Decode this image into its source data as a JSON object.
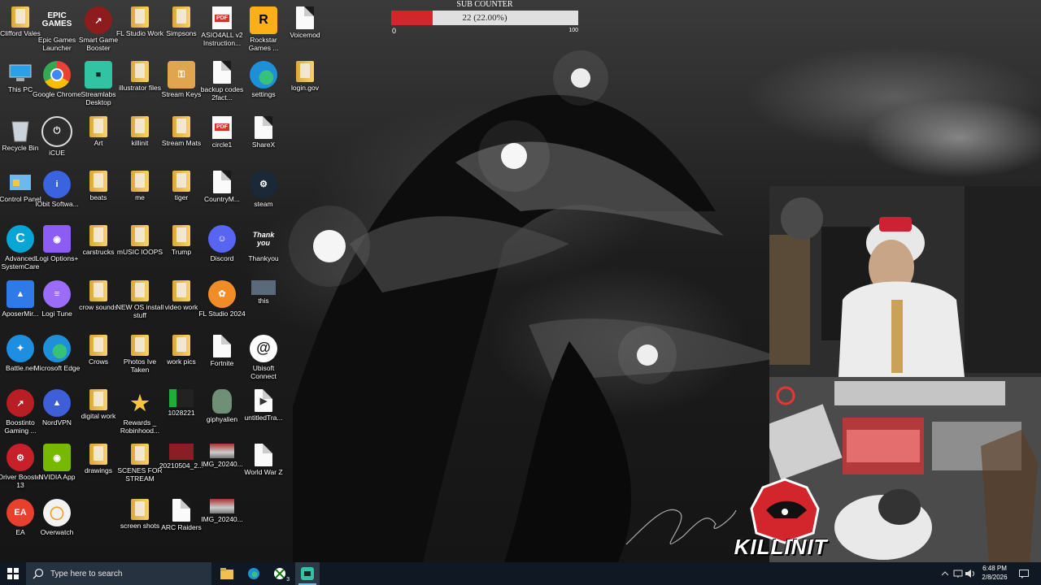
{
  "desktop": {
    "icons": [
      {
        "label": "Clifford Vales",
        "icon": "folder-user-icon",
        "type": "folder"
      },
      {
        "label": "This PC",
        "icon": "this-pc-icon",
        "type": "pc"
      },
      {
        "label": "Recycle Bin",
        "icon": "recycle-bin-icon",
        "type": "bin"
      },
      {
        "label": "Control Panel",
        "icon": "control-panel-icon",
        "type": "cp"
      },
      {
        "label": "Advanced SystemCare",
        "icon": "advanced-systemcare-icon",
        "type": "asc"
      },
      {
        "label": "AposerMir...",
        "icon": "apowermirror-icon",
        "type": "apower"
      },
      {
        "label": "Battle.net",
        "icon": "battlenet-icon",
        "type": "battle"
      },
      {
        "label": "Boostinto Gaming ...",
        "icon": "boost-gaming-icon",
        "type": "boost"
      },
      {
        "label": "Driver Booster 13",
        "icon": "driver-booster-icon",
        "type": "driver"
      },
      {
        "label": "EA",
        "icon": "ea-icon",
        "type": "ea"
      },
      {
        "label": "Epic Games Launcher",
        "icon": "epic-games-icon",
        "type": "epic"
      },
      {
        "label": "Google Chrome",
        "icon": "chrome-icon",
        "type": "chrome"
      },
      {
        "label": "iCUE",
        "icon": "icue-icon",
        "type": "icue"
      },
      {
        "label": "IObit Softwa...",
        "icon": "iobit-icon",
        "type": "iobit"
      },
      {
        "label": "Logi Options+",
        "icon": "logi-options-icon",
        "type": "logi"
      },
      {
        "label": "Logi Tune",
        "icon": "logi-tune-icon",
        "type": "logitune"
      },
      {
        "label": "Microsoft Edge",
        "icon": "edge-icon",
        "type": "edge"
      },
      {
        "label": "NordVPN",
        "icon": "nordvpn-icon",
        "type": "nord"
      },
      {
        "label": "NVIDIA App",
        "icon": "nvidia-icon",
        "type": "nvidia"
      },
      {
        "label": "Overwatch",
        "icon": "overwatch-icon",
        "type": "overwatch"
      },
      {
        "label": "Smart Game Booster",
        "icon": "smart-game-booster-icon",
        "type": "sgb"
      },
      {
        "label": "Streamlabs Desktop",
        "icon": "streamlabs-icon",
        "type": "streamlabs"
      },
      {
        "label": "Art",
        "icon": "folder-icon",
        "type": "folder"
      },
      {
        "label": "beats",
        "icon": "folder-icon",
        "type": "folder"
      },
      {
        "label": "carstrucks",
        "icon": "folder-icon",
        "type": "folder"
      },
      {
        "label": "crow sounds",
        "icon": "folder-icon",
        "type": "folder"
      },
      {
        "label": "Crows",
        "icon": "folder-icon",
        "type": "folder"
      },
      {
        "label": "digital work",
        "icon": "folder-icon",
        "type": "folder"
      },
      {
        "label": "drawings",
        "icon": "folder-icon",
        "type": "folder"
      },
      {
        "label": "FL Studio Work",
        "icon": "folder-icon",
        "type": "folder"
      },
      {
        "label": "illustrator files",
        "icon": "folder-icon",
        "type": "folder"
      },
      {
        "label": "killinit",
        "icon": "folder-icon",
        "type": "folder"
      },
      {
        "label": "me",
        "icon": "folder-icon",
        "type": "folder"
      },
      {
        "label": "mUSIC lOOPS",
        "icon": "folder-icon",
        "type": "folder"
      },
      {
        "label": "NEW OS install stuff",
        "icon": "folder-icon",
        "type": "folder"
      },
      {
        "label": "Photos Ive Taken",
        "icon": "folder-icon",
        "type": "folder"
      },
      {
        "label": "Rewards _ Robinhood...",
        "icon": "rewards-star-icon",
        "type": "star"
      },
      {
        "label": "SCENES FOR STREAM",
        "icon": "folder-icon",
        "type": "folder"
      },
      {
        "label": "screen shots",
        "icon": "folder-icon",
        "type": "folder"
      },
      {
        "label": "Simpsons",
        "icon": "folder-icon",
        "type": "folder"
      },
      {
        "label": "Stream Keys",
        "icon": "stream-keys-icon",
        "type": "keys"
      },
      {
        "label": "Stream Mats",
        "icon": "folder-icon",
        "type": "folder"
      },
      {
        "label": "tiger",
        "icon": "folder-icon",
        "type": "folder"
      },
      {
        "label": "Trump",
        "icon": "folder-icon",
        "type": "folder"
      },
      {
        "label": "video work",
        "icon": "folder-icon",
        "type": "folder"
      },
      {
        "label": "work pics",
        "icon": "folder-icon",
        "type": "folder"
      },
      {
        "label": "1028221",
        "icon": "image-file-icon",
        "type": "img1"
      },
      {
        "label": "20210504_2...",
        "icon": "image-file-icon",
        "type": "img2"
      },
      {
        "label": "ARC Raiders",
        "icon": "document-icon",
        "type": "doc"
      },
      {
        "label": "ASIO4ALL v2 Instruction...",
        "icon": "pdf-icon",
        "type": "pdf"
      },
      {
        "label": "backup codes 2fact...",
        "icon": "document-icon",
        "type": "doc"
      },
      {
        "label": "circle1",
        "icon": "pdf-icon",
        "type": "pdf"
      },
      {
        "label": "CountryM...",
        "icon": "document-icon",
        "type": "doc"
      },
      {
        "label": "Discord",
        "icon": "discord-icon",
        "type": "discord"
      },
      {
        "label": "FL Studio 2024",
        "icon": "fl-studio-icon",
        "type": "fl"
      },
      {
        "label": "Fortnite",
        "icon": "document-icon",
        "type": "doc"
      },
      {
        "label": "giphyalien",
        "icon": "alien-image-icon",
        "type": "alien"
      },
      {
        "label": "IMG_20240...",
        "icon": "image-file-icon",
        "type": "img3"
      },
      {
        "label": "IMG_20240...",
        "icon": "image-file-icon",
        "type": "img3"
      },
      {
        "label": "Rockstar Games ...",
        "icon": "rockstar-icon",
        "type": "rockstar"
      },
      {
        "label": "settings",
        "icon": "edge-icon",
        "type": "edge"
      },
      {
        "label": "ShareX",
        "icon": "document-icon",
        "type": "doc"
      },
      {
        "label": "steam",
        "icon": "steam-icon",
        "type": "steam"
      },
      {
        "label": "Thankyou",
        "icon": "thankyou-image-icon",
        "type": "thanks"
      },
      {
        "label": "this",
        "icon": "image-file-icon",
        "type": "thisimg"
      },
      {
        "label": "Ubisoft Connect",
        "icon": "ubisoft-icon",
        "type": "ubisoft"
      },
      {
        "label": "untitledTra...",
        "icon": "audio-file-icon",
        "type": "audio"
      },
      {
        "label": "World War Z",
        "icon": "document-icon",
        "type": "doc"
      },
      {
        "label": "Voicemod",
        "icon": "document-icon",
        "type": "doc"
      },
      {
        "label": "login.gov",
        "icon": "folder-icon",
        "type": "folder"
      }
    ]
  },
  "sub_counter": {
    "title": "SUB COUNTER",
    "value_text": "22 (22.00%)",
    "fraction": 0.22,
    "min": "0",
    "max": "100"
  },
  "overlay": {
    "logo_text": "KILLINIT",
    "accent": "#d2252c"
  },
  "taskbar": {
    "search_placeholder": "Type here to search",
    "badge": "3",
    "time": "6:48 PM",
    "date": "2/8/2026"
  }
}
